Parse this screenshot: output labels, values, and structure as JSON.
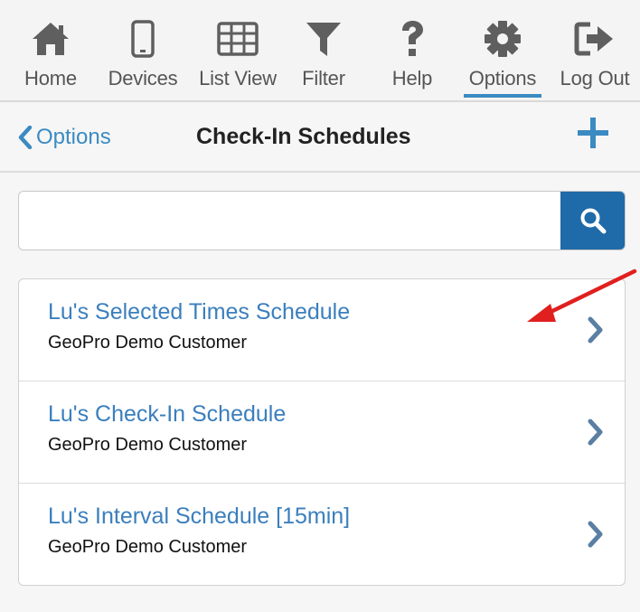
{
  "tabs": [
    {
      "label": "Home",
      "icon": "home-icon",
      "active": false
    },
    {
      "label": "Devices",
      "icon": "device-icon",
      "active": false
    },
    {
      "label": "List View",
      "icon": "grid-icon",
      "active": false
    },
    {
      "label": "Filter",
      "icon": "filter-icon",
      "active": false
    },
    {
      "label": "Help",
      "icon": "help-icon",
      "active": false
    },
    {
      "label": "Options",
      "icon": "gear-icon",
      "active": true
    },
    {
      "label": "Log Out",
      "icon": "logout-icon",
      "active": false
    }
  ],
  "header": {
    "back_label": "Options",
    "title": "Check-In Schedules"
  },
  "search": {
    "value": "",
    "placeholder": ""
  },
  "schedules": [
    {
      "name": "Lu's Selected Times Schedule",
      "customer": "GeoPro Demo Customer"
    },
    {
      "name": "Lu's Check-In Schedule",
      "customer": "GeoPro Demo Customer"
    },
    {
      "name": "Lu's Interval Schedule [15min]",
      "customer": "GeoPro Demo Customer"
    }
  ],
  "colors": {
    "accent": "#3b8bc2",
    "search_button": "#1f6aa8",
    "icon_gray": "#5f5f5f",
    "annotation_arrow": "#e0201f"
  }
}
